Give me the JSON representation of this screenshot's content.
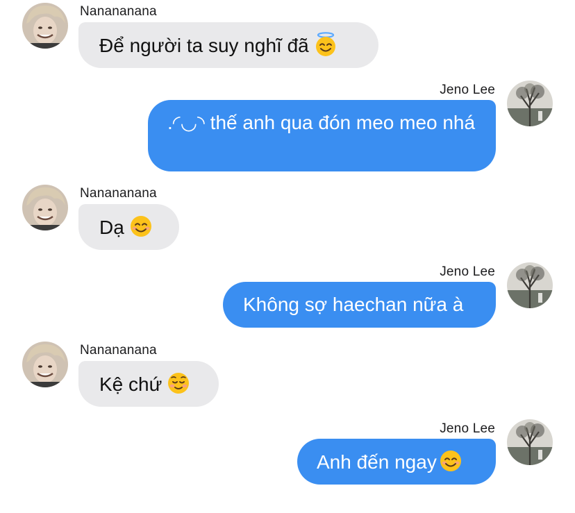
{
  "contacts": {
    "other_name": "Nanananana",
    "me_name": "Jeno Lee"
  },
  "messages": [
    {
      "side": "in",
      "sender": "Nanananana",
      "text": "Để người ta suy nghĩ đã",
      "emoji": "smiling-face-with-halo-icon"
    },
    {
      "side": "out",
      "sender": "Jeno Lee",
      "text": ".◜◡◝ thế anh qua đón meo meo nhá",
      "emoji": ""
    },
    {
      "side": "in",
      "sender": "Nanananana",
      "text": "Dạ",
      "emoji": "smiling-face-with-smiling-eyes-icon"
    },
    {
      "side": "out",
      "sender": "Jeno Lee",
      "text": "Không sợ haechan nữa à",
      "emoji": ""
    },
    {
      "side": "in",
      "sender": "Nanananana",
      "text": "Kệ chứ",
      "emoji": "smiling-face-icon"
    },
    {
      "side": "out",
      "sender": "Jeno Lee",
      "text": "Anh đến ngay",
      "emoji": "smiling-face-with-smiling-eyes-icon"
    }
  ],
  "colors": {
    "incoming_bubble": "#e9e9eb",
    "outgoing_bubble": "#3a8ef1",
    "incoming_text": "#111111",
    "outgoing_text": "#ffffff"
  }
}
